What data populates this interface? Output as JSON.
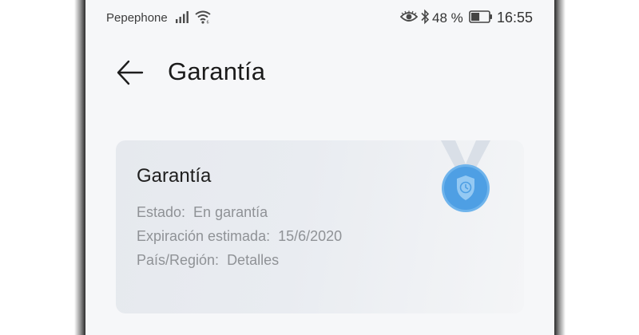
{
  "status_bar": {
    "carrier": "Pepephone",
    "battery_percent": "48 %",
    "battery_level": 0.48,
    "time": "16:55",
    "icons": [
      "signal-icon",
      "wifi-icon",
      "eye-icon",
      "bluetooth-icon",
      "battery-icon"
    ]
  },
  "header": {
    "back_icon": "back-arrow-icon",
    "title": "Garantía"
  },
  "card": {
    "title": "Garantía",
    "icon": "warranty-medal-icon",
    "rows": [
      {
        "label": "Estado:",
        "value": "En garantía"
      },
      {
        "label": "Expiración estimada:",
        "value": "15/6/2020"
      },
      {
        "label": "País/Región:",
        "value": "Detalles"
      }
    ]
  },
  "colors": {
    "accent": "#4a9ee6",
    "text_primary": "#1b1b1b",
    "text_secondary": "#8f9296",
    "card_bg": "#e8ebf0"
  }
}
